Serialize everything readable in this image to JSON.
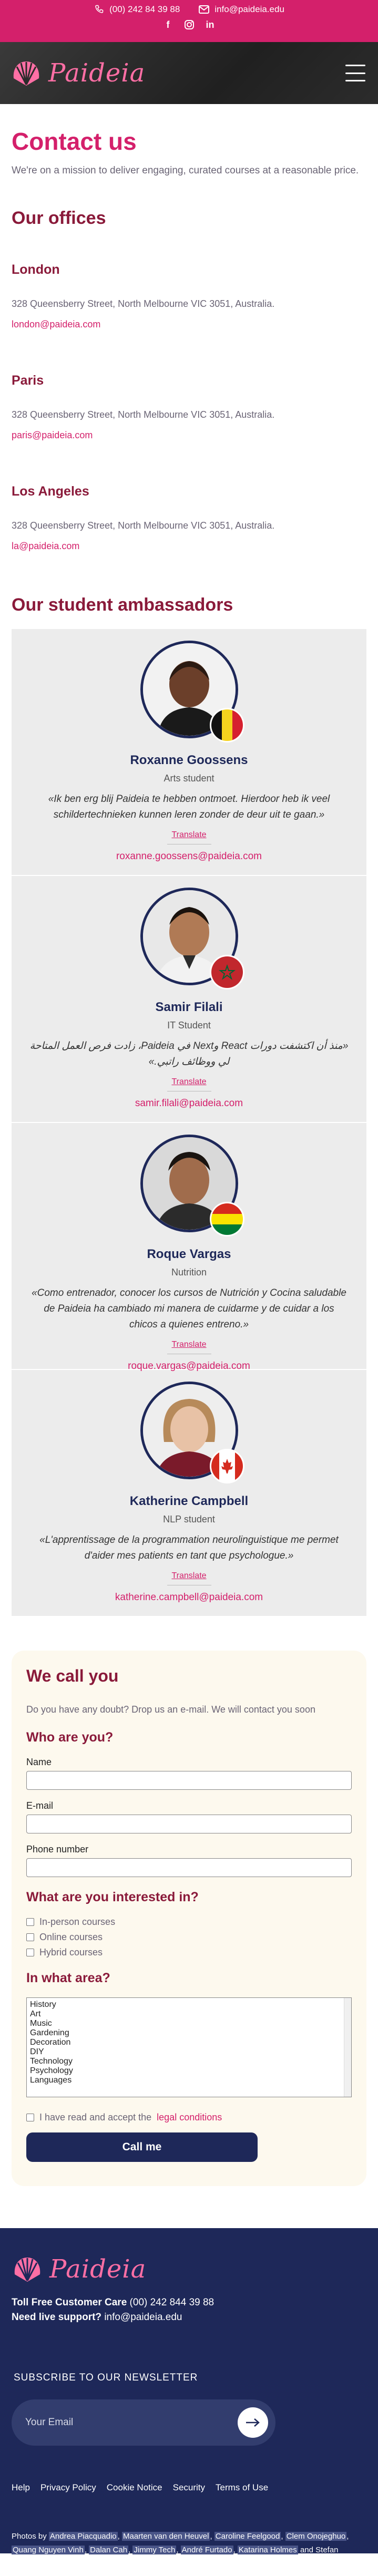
{
  "topbar": {
    "phone": "(00) 242 84 39 88",
    "email": "info@paideia.edu",
    "social": [
      "facebook-icon",
      "instagram-icon",
      "linkedin-icon"
    ]
  },
  "header": {
    "logo_text": "Paideia"
  },
  "hero": {
    "title": "Contact us",
    "text": "We're on a mission to deliver engaging, curated courses at a reasonable price."
  },
  "offices": {
    "title": "Our offices",
    "items": [
      {
        "city": "London",
        "address": "328 Queensberry Street, North Melbourne VIC 3051, Australia.",
        "email": "london@paideia.com"
      },
      {
        "city": "Paris",
        "address": "328 Queensberry Street, North Melbourne VIC 3051, Australia.",
        "email": "paris@paideia.com"
      },
      {
        "city": "Los Angeles",
        "address": "328 Queensberry Street, North Melbourne VIC 3051, Australia.",
        "email": "la@paideia.com"
      }
    ]
  },
  "ambassadors": {
    "title": "Our student ambassadors",
    "translate_label": "Translate",
    "items": [
      {
        "name": "Roxanne Goossens",
        "role": "Arts student",
        "quote": "«Ik ben erg blij Paideia te hebben ontmoet. Hierdoor heb ik veel schildertechnieken kunnen leren zonder de deur uit te gaan.»",
        "email": "roxanne.goossens@paideia.com",
        "flag": "belgium"
      },
      {
        "name": "Samir Filali",
        "role": "IT Student",
        "quote": "«منذ أن اكتشفت دورات React وNext في Paideia، زادت فرص العمل المتاحة لي ووظائف راتبي.»",
        "email": "samir.filali@paideia.com",
        "flag": "morocco"
      },
      {
        "name": "Roque Vargas",
        "role": "Nutrition",
        "quote": "«Como entrenador, conocer los cursos de Nutrición y Cocina saludable de Paideia ha cambiado mi manera de cuidarme y de cuidar a los chicos a quienes entreno.»",
        "email": "roque.vargas@paideia.com",
        "flag": "bolivia"
      },
      {
        "name": "Katherine Campbell",
        "role": "NLP student",
        "quote": "«L'apprentissage de la programmation neurolinguistique me permet d'aider mes patients en tant que psychologue.»",
        "email": "katherine.campbell@paideia.com",
        "flag": "canada"
      }
    ]
  },
  "form": {
    "title": "We call you",
    "intro": "Do you have any doubt? Drop us an e-mail. We will contact you soon",
    "who_title": "Who are you?",
    "name_label": "Name",
    "email_label": "E-mail",
    "phone_label": "Phone number",
    "interest_title": "What are you interested in?",
    "interest_options": [
      "In-person courses",
      "Online courses",
      "Hybrid courses"
    ],
    "area_title": "In what area?",
    "area_options": [
      "History",
      "Art",
      "Music",
      "Gardening",
      "Decoration",
      "DIY",
      "Technology",
      "Psychology",
      "Languages"
    ],
    "legal_text": "I have read and accept the",
    "legal_link": "legal conditions",
    "submit_label": "Call me"
  },
  "footer": {
    "logo_text": "Paideia",
    "care_label": "Toll Free Customer Care",
    "care_phone": "(00) 242 844 39 88",
    "support_label": "Need live support?",
    "support_email": "info@paideia.edu",
    "newsletter_title": "SUBSCRIBE TO OUR NEWSLETTER",
    "newsletter_placeholder": "Your Email",
    "links": [
      "Help",
      "Privacy Policy",
      "Cookie Notice",
      "Security",
      "Terms of Use"
    ],
    "credits_prefix": "Photos by",
    "credits": [
      "Andrea Piacquadio",
      "Maarten van den Heuvel",
      "Caroline Feelgood",
      "Clem Onojeghuo",
      "Quang Nguyen Vinh",
      "Dalan Cah",
      "Jimmy Tech",
      "André Furtado",
      "Katarina Holmes"
    ],
    "credits_suffix": "and Stefan Schwiwhofer."
  },
  "colors": {
    "brand_pink": "#d4206b",
    "brand_navy": "#1e2859",
    "heading_maroon": "#8a1a3a"
  }
}
